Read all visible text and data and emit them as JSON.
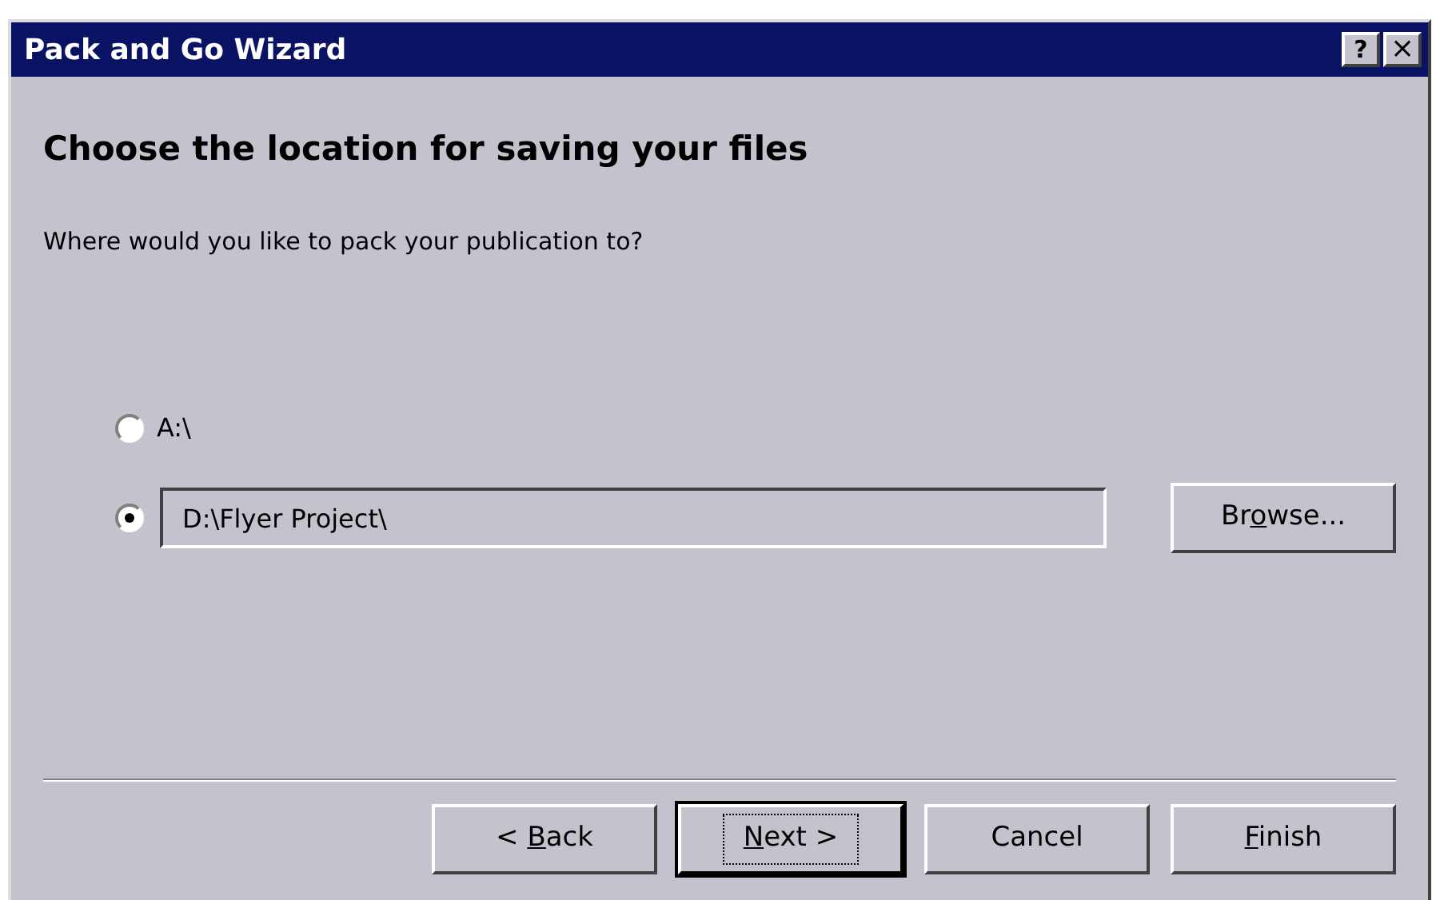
{
  "window": {
    "title": "Pack and Go Wizard",
    "help_button": "?",
    "close_button": "×"
  },
  "heading": "Choose the location for saving your files",
  "question": "Where would you like to pack your publication to?",
  "options": [
    {
      "kind": "label",
      "text": "A:\\",
      "selected": false
    },
    {
      "kind": "path_field",
      "value": "D:\\Flyer Project\\",
      "selected": true
    }
  ],
  "browse_button": {
    "before": "Br",
    "access_key": "o",
    "after": "wse...",
    "focused": false
  },
  "buttons": [
    {
      "before": "< ",
      "access_key": "B",
      "after": "ack",
      "focused": false
    },
    {
      "access_key": "N",
      "after": "ext >",
      "focused": true
    },
    {
      "before": "Cancel",
      "focused": false
    },
    {
      "access_key": "F",
      "after": "inish",
      "focused": false
    }
  ]
}
